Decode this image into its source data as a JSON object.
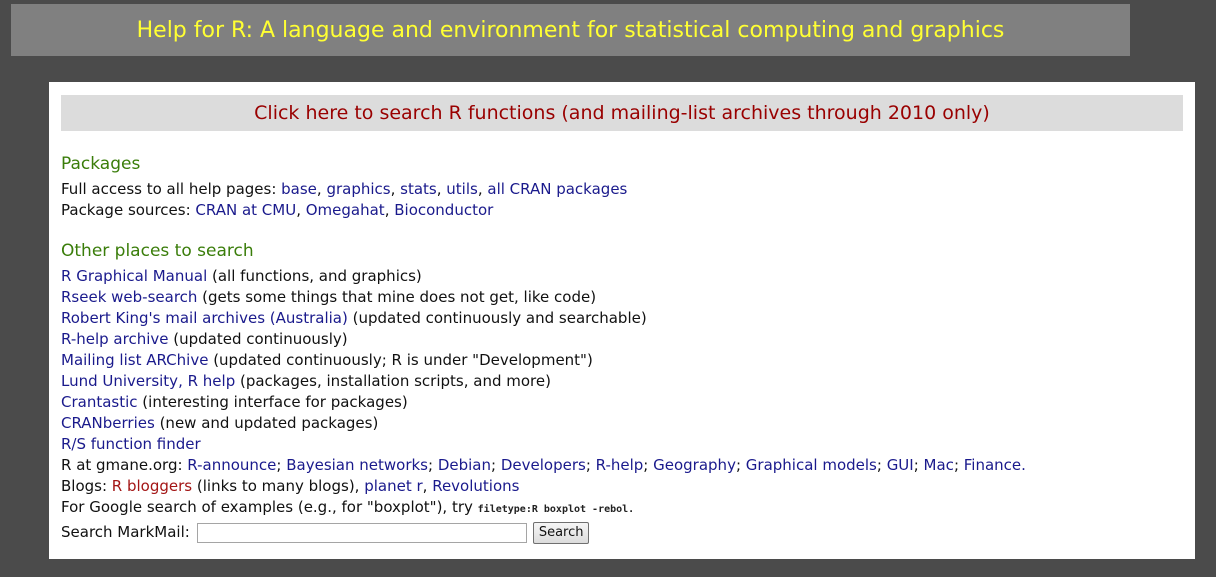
{
  "header": {
    "title": "Help for R: A language and environment for statistical computing and graphics"
  },
  "search_banner": {
    "label": "Click here to search R functions (and mailing-list archives through 2010 only)"
  },
  "packages": {
    "heading": "Packages",
    "help_pages_label": "Full access to all help pages: ",
    "help_pages_links": [
      "base",
      "graphics",
      "stats",
      "utils",
      "all CRAN packages"
    ],
    "sources_label": "Package sources: ",
    "sources_links": [
      "CRAN at CMU",
      "Omegahat",
      "Bioconductor"
    ]
  },
  "other": {
    "heading": "Other places to search",
    "items": [
      {
        "link": "R Graphical Manual",
        "note": " (all functions, and graphics)"
      },
      {
        "link": "Rseek web-search",
        "note": " (gets some things that mine does not get, like code)"
      },
      {
        "link": "Robert King's mail archives (Australia)",
        "note": " (updated continuously and searchable)"
      },
      {
        "link": "R-help archive",
        "note": " (updated continuously)"
      },
      {
        "link": "Mailing list ARChive",
        "note": " (updated continuously; R is under \"Development\")"
      },
      {
        "link": "Lund University, R help",
        "note": " (packages, installation scripts, and more)"
      },
      {
        "link": "Crantastic",
        "note": " (interesting interface for packages)"
      },
      {
        "link": "CRANberries",
        "note": " (new and updated packages)"
      },
      {
        "link": "R/S function finder",
        "note": ""
      }
    ],
    "gmane_label": "R at gmane.org: ",
    "gmane_links": [
      "R-announce",
      "Bayesian networks",
      "Debian",
      "Developers",
      "R-help",
      "Geography",
      "Graphical models",
      "GUI",
      "Mac",
      "Finance"
    ],
    "blogs_label": "Blogs: ",
    "blogs_first_link": "R bloggers",
    "blogs_first_note": " (links to many blogs), ",
    "blogs_links": [
      "planet r",
      "Revolutions"
    ],
    "google_text": "For Google search of examples (e.g., for \"boxplot\"), try ",
    "google_code": "filetype:R boxplot -rebol.",
    "markmail_label": "Search MarkMail:",
    "markmail_value": "",
    "markmail_button": "Search"
  }
}
